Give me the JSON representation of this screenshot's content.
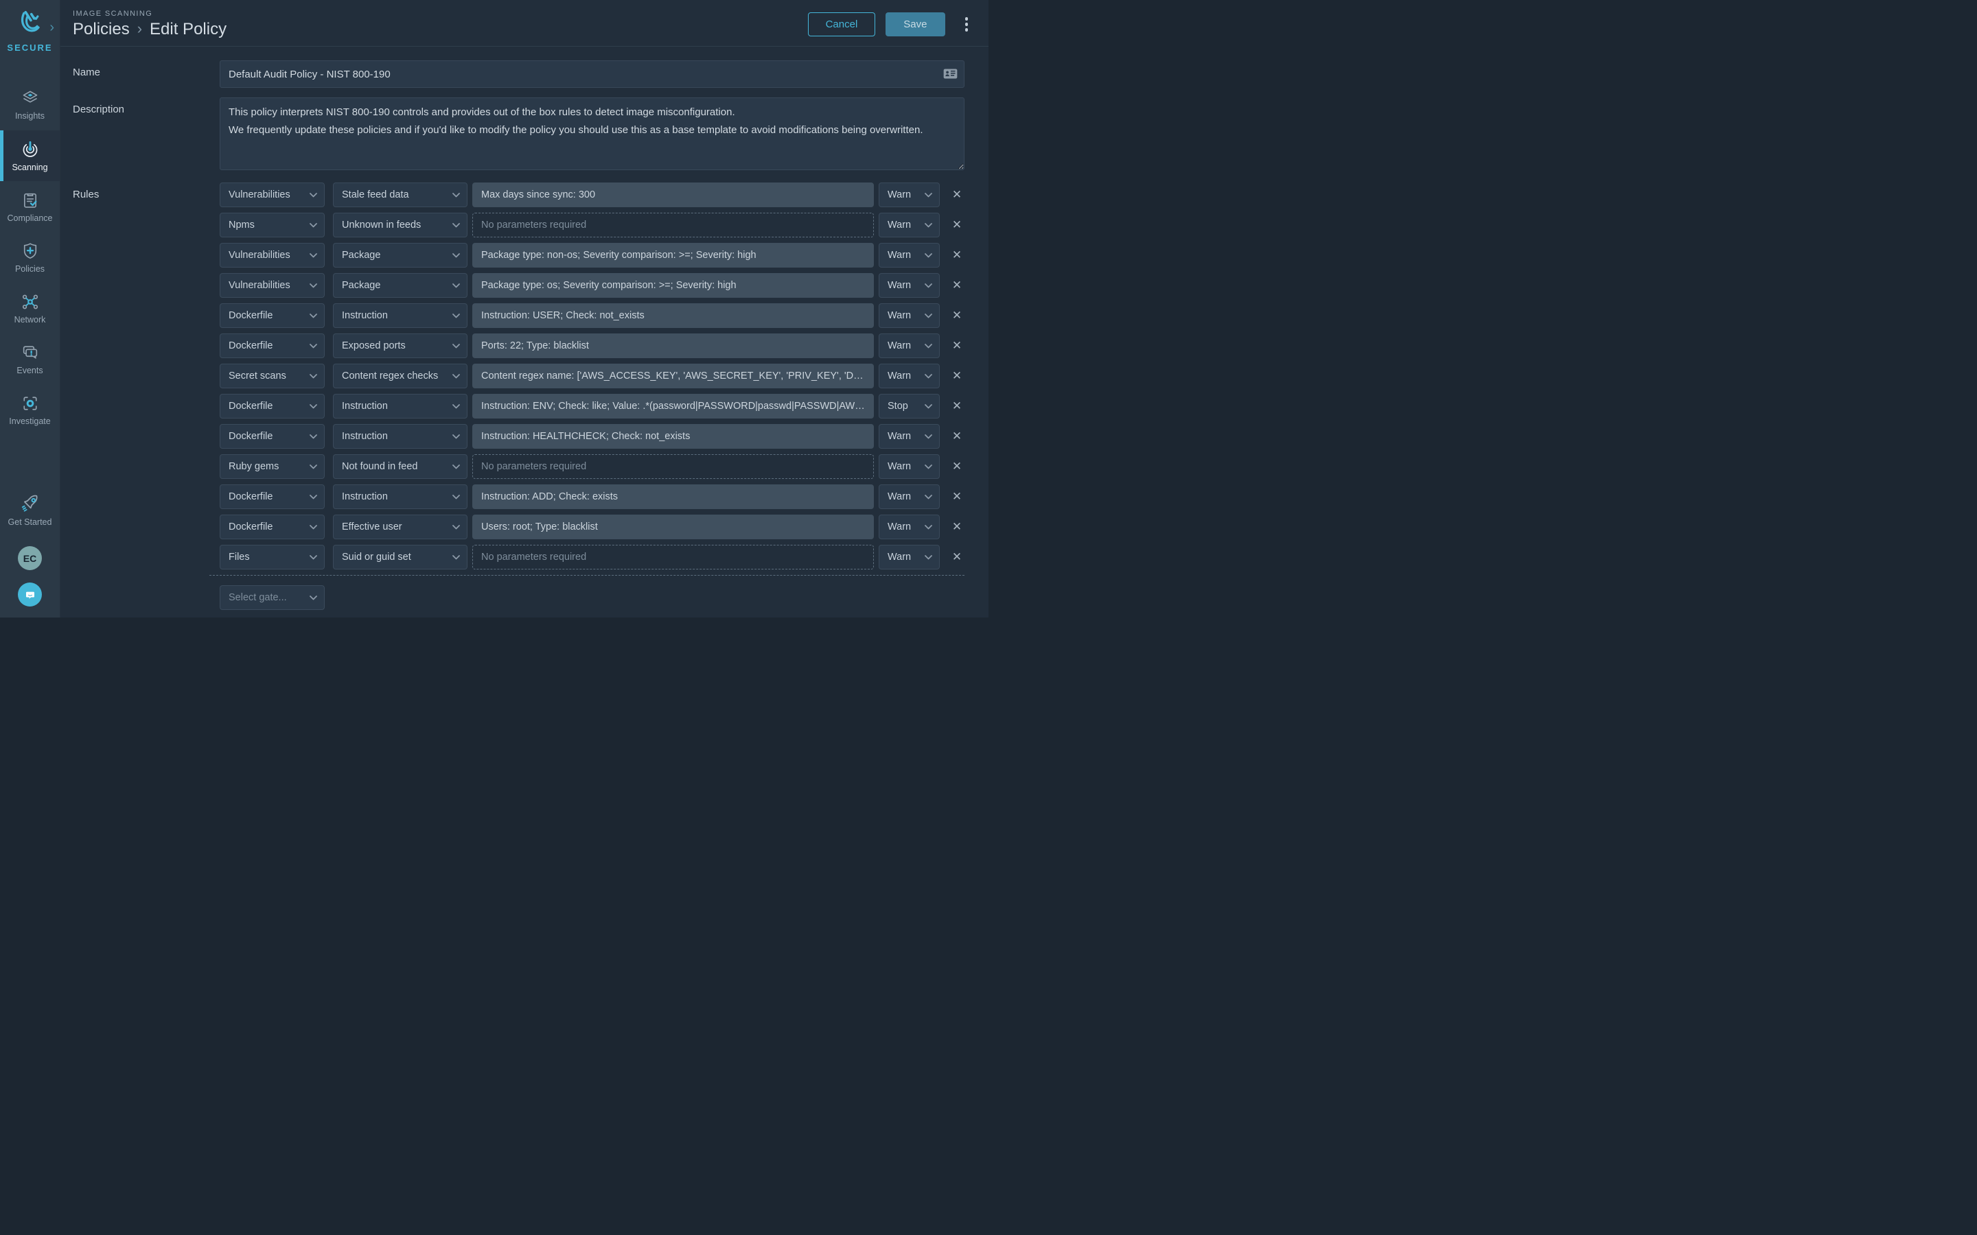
{
  "brand": {
    "name": "SECURE",
    "accent_color": "#45b6d9"
  },
  "header": {
    "section": "IMAGE SCANNING",
    "breadcrumb": {
      "parent": "Policies",
      "separator": "›",
      "current": "Edit Policy"
    },
    "cancel_label": "Cancel",
    "save_label": "Save"
  },
  "sidebar": {
    "items": [
      {
        "label": "Insights",
        "icon": "layers-icon",
        "active": false
      },
      {
        "label": "Scanning",
        "icon": "radar-icon",
        "active": true
      },
      {
        "label": "Compliance",
        "icon": "clipboard-check-icon",
        "active": false
      },
      {
        "label": "Policies",
        "icon": "shield-plus-icon",
        "active": false
      },
      {
        "label": "Network",
        "icon": "network-nodes-icon",
        "active": false
      },
      {
        "label": "Events",
        "icon": "chat-alert-icon",
        "active": false
      },
      {
        "label": "Investigate",
        "icon": "viewfinder-icon",
        "active": false
      }
    ],
    "footer": {
      "get_started_label": "Get Started",
      "avatar_initials": "EC"
    }
  },
  "form": {
    "name": {
      "label": "Name",
      "value": "Default Audit Policy - NIST 800-190"
    },
    "description": {
      "label": "Description",
      "value": "This policy interprets NIST 800-190 controls and provides out of the box rules to detect image misconfiguration.\nWe frequently update these policies and if you'd like to modify the policy you should use this as a base template to avoid modifications being overwritten."
    },
    "rules": {
      "label": "Rules",
      "no_params_text": "No parameters required",
      "select_gate_placeholder": "Select gate...",
      "rows": [
        {
          "gate": "Vulnerabilities",
          "trigger": "Stale feed data",
          "params": "Max days since sync: 300",
          "action": "Warn"
        },
        {
          "gate": "Npms",
          "trigger": "Unknown in feeds",
          "params": null,
          "action": "Warn"
        },
        {
          "gate": "Vulnerabilities",
          "trigger": "Package",
          "params": "Package type: non-os; Severity comparison: >=; Severity: high",
          "action": "Warn"
        },
        {
          "gate": "Vulnerabilities",
          "trigger": "Package",
          "params": "Package type: os; Severity comparison: >=; Severity: high",
          "action": "Warn"
        },
        {
          "gate": "Dockerfile",
          "trigger": "Instruction",
          "params": "Instruction: USER; Check: not_exists",
          "action": "Warn"
        },
        {
          "gate": "Dockerfile",
          "trigger": "Exposed ports",
          "params": "Ports: 22; Type: blacklist",
          "action": "Warn"
        },
        {
          "gate": "Secret scans",
          "trigger": "Content regex checks",
          "params": "Content regex name: ['AWS_ACCESS_KEY', 'AWS_SECRET_KEY', 'PRIV_KEY', 'DOCKER_A...",
          "action": "Warn"
        },
        {
          "gate": "Dockerfile",
          "trigger": "Instruction",
          "params": "Instruction: ENV; Check: like; Value: .*(password|PASSWORD|passwd|PASSWD|AWS|secr...",
          "action": "Stop"
        },
        {
          "gate": "Dockerfile",
          "trigger": "Instruction",
          "params": "Instruction: HEALTHCHECK; Check: not_exists",
          "action": "Warn"
        },
        {
          "gate": "Ruby gems",
          "trigger": "Not found in feed",
          "params": null,
          "action": "Warn"
        },
        {
          "gate": "Dockerfile",
          "trigger": "Instruction",
          "params": "Instruction: ADD; Check: exists",
          "action": "Warn"
        },
        {
          "gate": "Dockerfile",
          "trigger": "Effective user",
          "params": "Users: root; Type: blacklist",
          "action": "Warn"
        },
        {
          "gate": "Files",
          "trigger": "Suid or guid set",
          "params": null,
          "action": "Warn"
        }
      ]
    }
  }
}
